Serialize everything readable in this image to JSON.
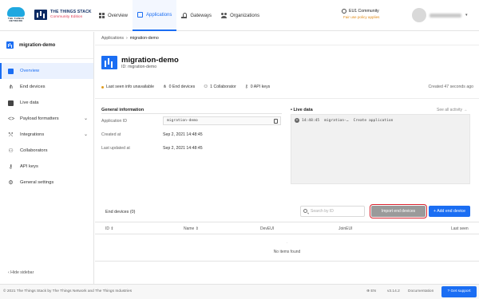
{
  "brand": {
    "ttn_wordmark": "THE THINGS NETWORK",
    "stack_line1": "THE THINGS STACK",
    "stack_line2": "Community Edition"
  },
  "nav": {
    "items": [
      {
        "label": "Overview",
        "icon": "grid-icon",
        "active": false
      },
      {
        "label": "Applications",
        "icon": "application-icon",
        "active": true
      },
      {
        "label": "Gateways",
        "icon": "gateway-icon",
        "active": false
      },
      {
        "label": "Organizations",
        "icon": "organization-icon",
        "active": false
      }
    ]
  },
  "cluster": {
    "name": "EU1 Community",
    "policy": "Fair use policy applies"
  },
  "sidebar": {
    "app_name": "migration-demo",
    "items": [
      {
        "label": "Overview",
        "icon": "overview-icon",
        "active": true
      },
      {
        "label": "End devices",
        "icon": "end-devices-icon"
      },
      {
        "label": "Live data",
        "icon": "live-data-icon"
      },
      {
        "label": "Payload formatters",
        "icon": "code-icon",
        "caret": true
      },
      {
        "label": "Integrations",
        "icon": "integrations-icon",
        "caret": true
      },
      {
        "label": "Collaborators",
        "icon": "collaborators-icon"
      },
      {
        "label": "API keys",
        "icon": "key-icon"
      },
      {
        "label": "General settings",
        "icon": "gear-icon"
      }
    ],
    "hide_label": "Hide sidebar"
  },
  "breadcrumb": {
    "root": "Applications",
    "current": "migration-demo"
  },
  "header": {
    "title": "migration-demo",
    "id_line": "ID: migration-demo",
    "last_seen": "Last seen info unavailable",
    "end_devices": "0 End devices",
    "collaborators": "1 Collaborator",
    "api_keys": "0 API keys",
    "created": "Created 47 seconds ago"
  },
  "general": {
    "title": "General information",
    "app_id_label": "Application ID",
    "app_id_value": "migration-demo",
    "created_label": "Created at",
    "created_value": "Sep 2, 2021 14:48:45",
    "updated_label": "Last updated at",
    "updated_value": "Sep 2, 2021 14:48:45"
  },
  "live": {
    "title": "Live data",
    "see_all": "See all activity →",
    "row": {
      "time": "14:48:45",
      "source": "migration-…",
      "event": "Create application"
    }
  },
  "devices": {
    "title": "End devices (0)",
    "search_placeholder": "Search by ID",
    "import_label": "Import end devices",
    "add_label": "+ Add end device",
    "columns": [
      "ID ⇕",
      "Name ⇕",
      "DevEUI",
      "JoinEUI",
      "Last seen"
    ],
    "empty_marker": "-",
    "empty": "No items found"
  },
  "footer": {
    "copyright": "© 2021 The Things Stack by The Things Network and The Things Industries",
    "lang": "EN",
    "version": "v3.14.2",
    "docs": "Documentation",
    "support": "Get support"
  }
}
